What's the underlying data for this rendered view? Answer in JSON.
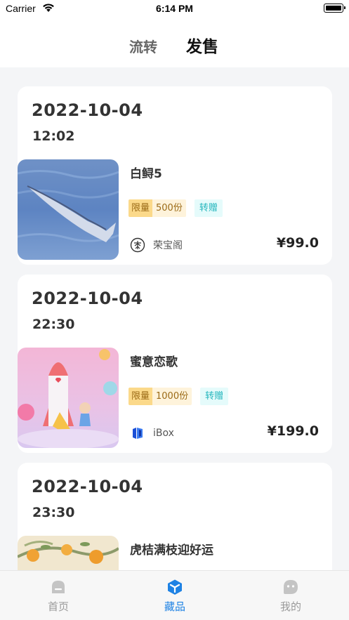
{
  "status_bar": {
    "carrier": "Carrier",
    "time": "6:14 PM"
  },
  "tabs": {
    "circulate": "流转",
    "sale": "发售"
  },
  "cards": [
    {
      "date": "2022-10-04",
      "time": "12:02",
      "title": "白鲟5",
      "limit_label": "限量",
      "limit_value": "500份",
      "gift": "转赠",
      "issuer": "荣宝阁",
      "issuer_icon": "rongbaoge-logo-icon",
      "price": "¥99.0"
    },
    {
      "date": "2022-10-04",
      "time": "22:30",
      "title": "蜜意恋歌",
      "limit_label": "限量",
      "limit_value": "1000份",
      "gift": "转赠",
      "issuer": "iBox",
      "issuer_icon": "ibox-logo-icon",
      "price": "¥199.0"
    },
    {
      "date": "2022-10-04",
      "time": "23:30",
      "title": "虎桔满枝迎好运"
    }
  ],
  "tabbar": [
    {
      "label": "首页",
      "icon": "home-icon"
    },
    {
      "label": "藏品",
      "icon": "collection-cube-icon",
      "active": true
    },
    {
      "label": "我的",
      "icon": "profile-icon"
    }
  ],
  "colors": {
    "accent": "#1e82e4",
    "limit_tag": "#fbd98a",
    "gift_tag": "#24b6bd"
  }
}
